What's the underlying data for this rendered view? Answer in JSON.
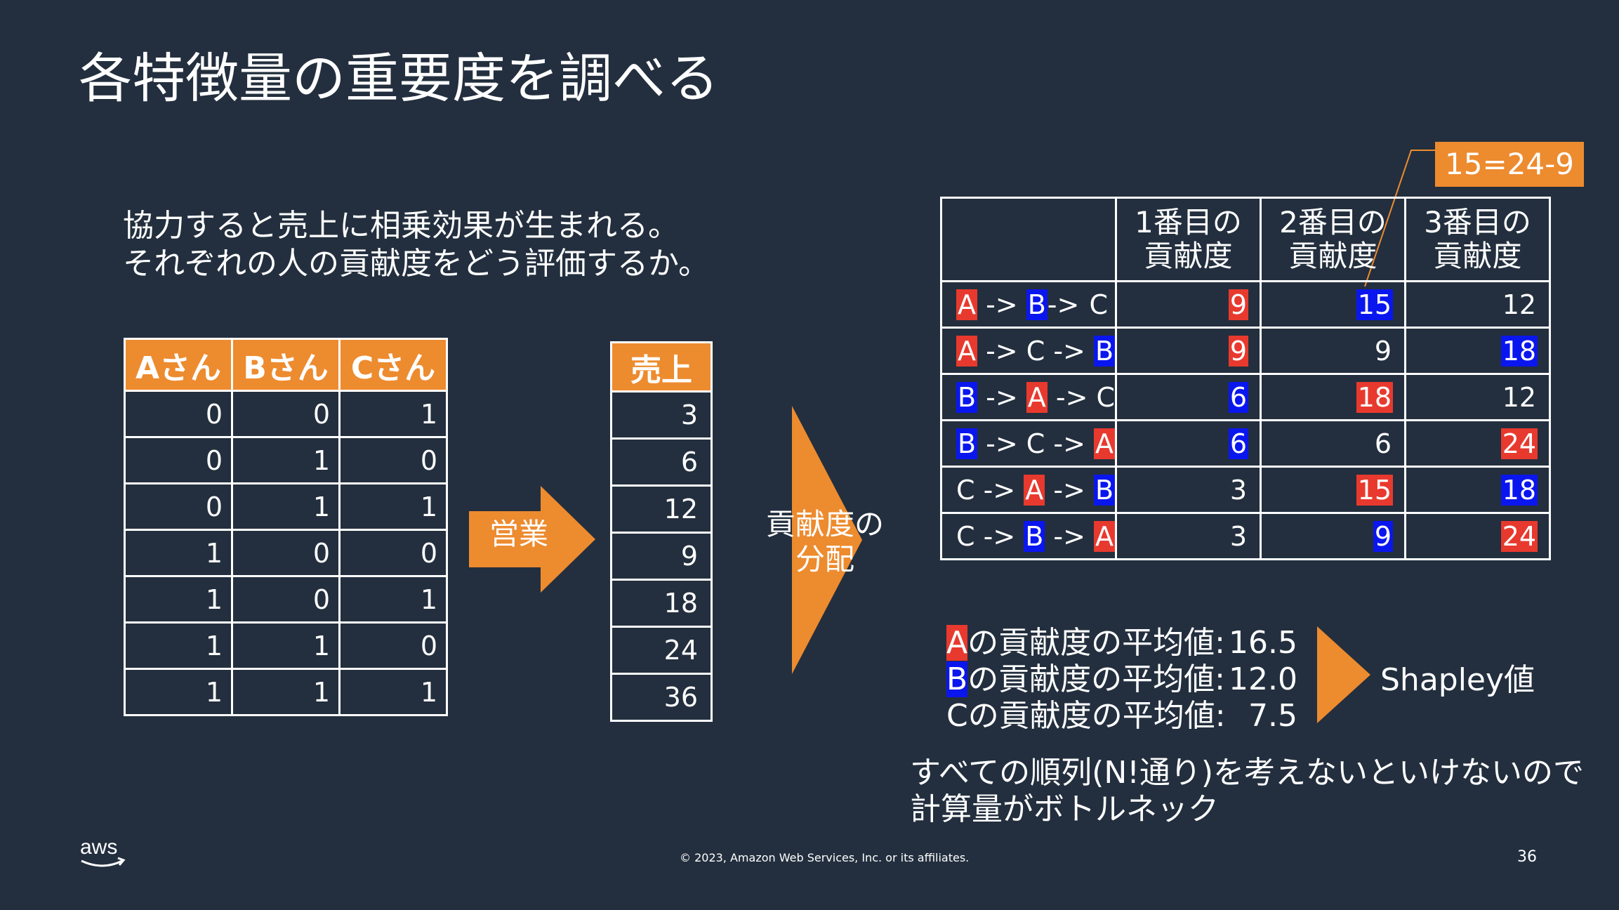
{
  "title": "各特徴量の重要度を調べる",
  "intro": [
    "協力すると売上に相乗効果が生まれる。",
    "それぞれの人の貢献度をどう評価するか。"
  ],
  "input_table": {
    "headers": [
      "Aさん",
      "Bさん",
      "Cさん"
    ],
    "rows": [
      [
        "0",
        "0",
        "1"
      ],
      [
        "0",
        "1",
        "0"
      ],
      [
        "0",
        "1",
        "1"
      ],
      [
        "1",
        "0",
        "0"
      ],
      [
        "1",
        "0",
        "1"
      ],
      [
        "1",
        "1",
        "0"
      ],
      [
        "1",
        "1",
        "1"
      ]
    ]
  },
  "arrow_sales_label": "営業",
  "sales_table": {
    "header": "売上",
    "values": [
      "3",
      "6",
      "12",
      "9",
      "18",
      "24",
      "36"
    ]
  },
  "arrow_distribute_label": [
    "貢献度の",
    "分配"
  ],
  "callout": "15=24-9",
  "contrib_table": {
    "headers": [
      [
        "1番目の",
        "貢献度"
      ],
      [
        "2番目の",
        "貢献度"
      ],
      [
        "3番目の",
        "貢献度"
      ]
    ],
    "rows": [
      {
        "order": [
          {
            "t": "A",
            "c": "A"
          },
          {
            "t": " -> ",
            "c": ""
          },
          {
            "t": "B",
            "c": "B"
          },
          {
            "t": "-> ",
            "c": ""
          },
          {
            "t": "C",
            "c": "C"
          }
        ],
        "vals": [
          {
            "v": "9",
            "c": "A"
          },
          {
            "v": "15",
            "c": "B"
          },
          {
            "v": "12",
            "c": "C"
          }
        ]
      },
      {
        "order": [
          {
            "t": "A",
            "c": "A"
          },
          {
            "t": " -> C -> ",
            "c": ""
          },
          {
            "t": "B",
            "c": "B"
          }
        ],
        "vals": [
          {
            "v": "9",
            "c": "A"
          },
          {
            "v": "9",
            "c": "C"
          },
          {
            "v": "18",
            "c": "B"
          }
        ]
      },
      {
        "order": [
          {
            "t": "B",
            "c": "B"
          },
          {
            "t": " -> ",
            "c": ""
          },
          {
            "t": "A",
            "c": "A"
          },
          {
            "t": " -> C",
            "c": ""
          }
        ],
        "vals": [
          {
            "v": "6",
            "c": "B"
          },
          {
            "v": "18",
            "c": "A"
          },
          {
            "v": "12",
            "c": "C"
          }
        ]
      },
      {
        "order": [
          {
            "t": "B",
            "c": "B"
          },
          {
            "t": " -> C -> ",
            "c": ""
          },
          {
            "t": "A",
            "c": "A"
          }
        ],
        "vals": [
          {
            "v": "6",
            "c": "B"
          },
          {
            "v": "6",
            "c": "C"
          },
          {
            "v": "24",
            "c": "A"
          }
        ]
      },
      {
        "order": [
          {
            "t": "C -> ",
            "c": ""
          },
          {
            "t": "A",
            "c": "A"
          },
          {
            "t": " -> ",
            "c": ""
          },
          {
            "t": "B",
            "c": "B"
          }
        ],
        "vals": [
          {
            "v": "3",
            "c": "C"
          },
          {
            "v": "15",
            "c": "A"
          },
          {
            "v": "18",
            "c": "B"
          }
        ]
      },
      {
        "order": [
          {
            "t": "C -> ",
            "c": ""
          },
          {
            "t": "B",
            "c": "B"
          },
          {
            "t": " -> ",
            "c": ""
          },
          {
            "t": "A",
            "c": "A"
          }
        ],
        "vals": [
          {
            "v": "3",
            "c": "C"
          },
          {
            "v": "9",
            "c": "B"
          },
          {
            "v": "24",
            "c": "A"
          }
        ]
      }
    ]
  },
  "averages": [
    {
      "letter": "A",
      "color": "A",
      "label": "の貢献度の平均値:",
      "value": "16.5"
    },
    {
      "letter": "B",
      "color": "B",
      "label": "の貢献度の平均値:",
      "value": "12.0"
    },
    {
      "letter": "C",
      "color": "C",
      "label": "の貢献度の平均値:",
      "value": "7.5"
    }
  ],
  "shapley_label": "Shapley値",
  "note": [
    "すべての順列(N!通り)を考えないといけないので",
    "計算量がボトルネック"
  ],
  "footer": "© 2023, Amazon Web Services, Inc. or its affiliates.",
  "page_number": "36",
  "logo_text": "aws",
  "colors": {
    "background": "#232f3e",
    "accent": "#ed8b2f",
    "highlight_A": "#e8392e",
    "highlight_B": "#0a16ee"
  }
}
